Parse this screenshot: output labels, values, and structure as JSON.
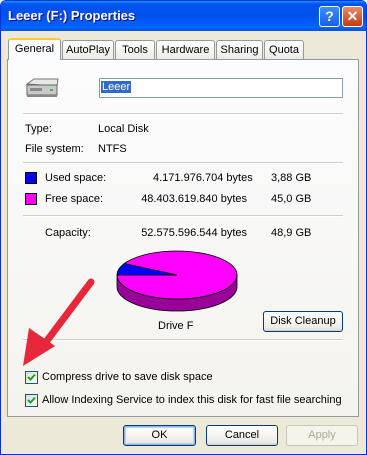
{
  "window": {
    "title": "Leeer (F:) Properties",
    "help_glyph": "?",
    "close_glyph": "✕"
  },
  "tabs": [
    {
      "label": "General",
      "active": true
    },
    {
      "label": "AutoPlay"
    },
    {
      "label": "Tools"
    },
    {
      "label": "Hardware"
    },
    {
      "label": "Sharing"
    },
    {
      "label": "Quota"
    }
  ],
  "drive": {
    "icon": "drive-icon",
    "label_value": "Leeer",
    "type_label": "Type:",
    "type_value": "Local Disk",
    "fs_label": "File system:",
    "fs_value": "NTFS"
  },
  "space": {
    "used": {
      "label": "Used space:",
      "bytes": "4.171.976.704 bytes",
      "size": "3,88 GB",
      "color": "#0000ff"
    },
    "free": {
      "label": "Free space:",
      "bytes": "48.403.619.840 bytes",
      "size": "45,0 GB",
      "color": "#ff00ff"
    },
    "capacity": {
      "label": "Capacity:",
      "bytes": "52.575.596.544 bytes",
      "size": "48,9 GB"
    },
    "used_fraction": 0.0794
  },
  "pie_caption": "Drive F",
  "buttons": {
    "disk_cleanup": "Disk Cleanup",
    "ok": "OK",
    "cancel": "Cancel",
    "apply": "Apply"
  },
  "options": {
    "compress": {
      "label": "Compress drive to save disk space",
      "checked": true
    },
    "indexing": {
      "label": "Allow Indexing Service to index this disk for fast file searching",
      "checked": true
    }
  },
  "annotation": {
    "arrow_color": "#e8283a"
  }
}
